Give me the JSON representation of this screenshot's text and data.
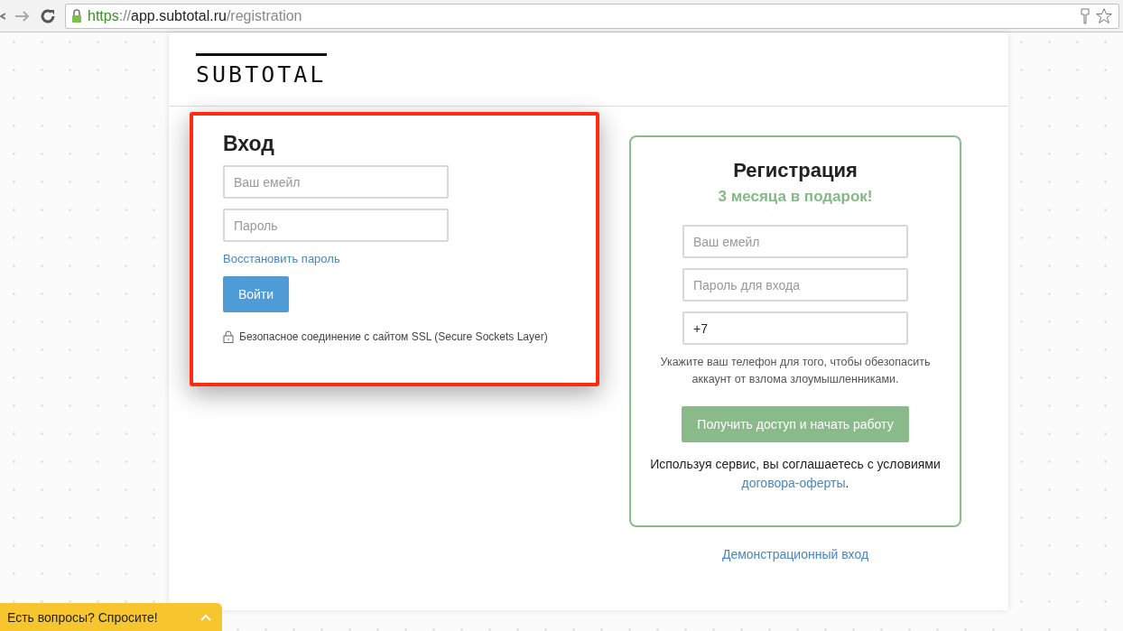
{
  "browser": {
    "url": {
      "scheme": "https",
      "separator": "://",
      "host": "app.subtotal.ru",
      "path": "/registration"
    }
  },
  "logo": "SUBTOTAL",
  "login": {
    "title": "Вход",
    "fields": [
      {
        "placeholder": "Ваш емейл"
      },
      {
        "placeholder": "Пароль"
      }
    ],
    "recover_link": "Восстановить пароль",
    "submit": "Войти",
    "ssl_note": "Безопасное соединение с сайтом SSL (Secure Sockets Layer)",
    "highlighted": true
  },
  "registration": {
    "title": "Регистрация",
    "promo": "3 месяца в подарок!",
    "fields": [
      {
        "placeholder": "Ваш емейл"
      },
      {
        "placeholder": "Пароль для входа"
      },
      {
        "value": "+7"
      }
    ],
    "phone_hint": "Укажите ваш телефон для того, чтобы обезопасить аккаунт от взлома злоумышленниками.",
    "submit": "Получить доступ и начать работу",
    "terms_text": "Используя сервис, вы соглашаетесь с условиями",
    "terms_link": "договора-оферты",
    "terms_end": "."
  },
  "demo_link": "Демонстрационный вход",
  "chat_widget": {
    "label": "Есть вопросы? Спросите!",
    "expanded": false
  }
}
